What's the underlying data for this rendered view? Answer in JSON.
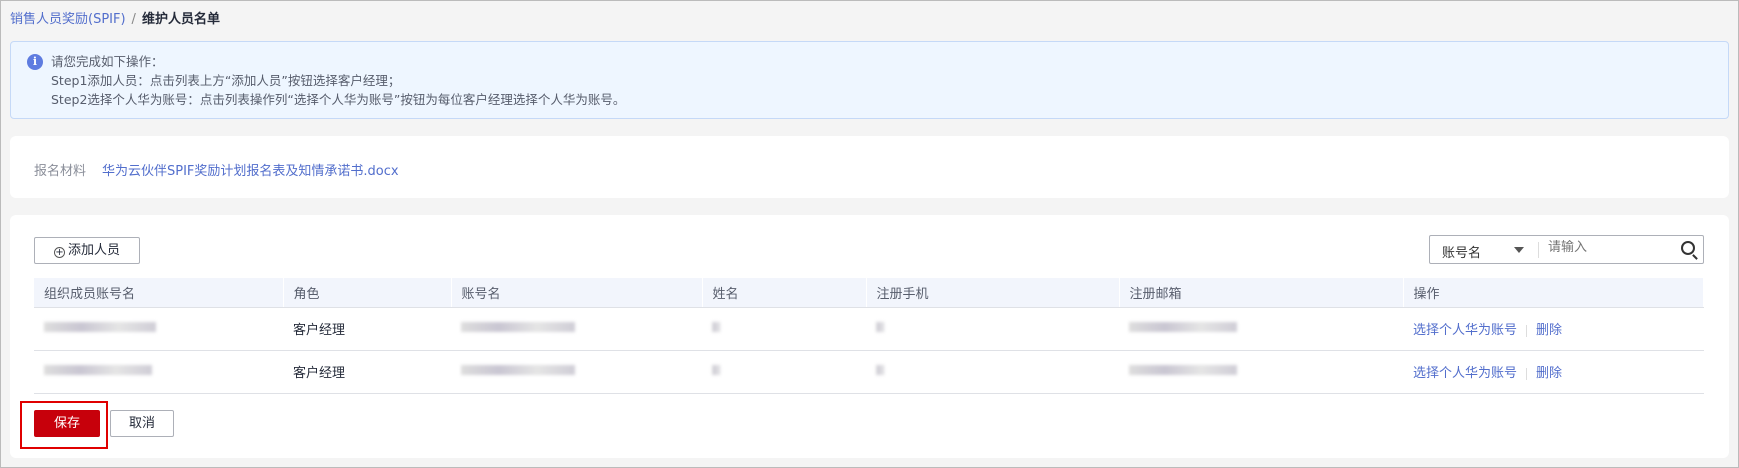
{
  "breadcrumb": {
    "parent": "销售人员奖励(SPIF)",
    "separator": "/",
    "current": "维护人员名单"
  },
  "info": {
    "icon": "info-icon",
    "lines": [
      "请您完成如下操作：",
      "Step1添加人员：点击列表上方“添加人员”按钮选择客户经理；",
      "Step2选择个人华为账号：点击列表操作列“选择个人华为账号”按钮为每位客户经理选择个人华为账号。"
    ]
  },
  "materials": {
    "label": "报名材料",
    "file": "华为云伙伴SPIF奖励计划报名表及知情承诺书.docx"
  },
  "toolbar": {
    "add_label": "添加人员",
    "search_field": "账号名",
    "search_placeholder": "请输入"
  },
  "table": {
    "columns": [
      "组织成员账号名",
      "角色",
      "账号名",
      "姓名",
      "注册手机",
      "注册邮箱",
      "操作"
    ],
    "rows": [
      {
        "role": "客户经理"
      },
      {
        "role": "客户经理"
      }
    ],
    "actions": {
      "select": "选择个人华为账号",
      "delete": "删除"
    }
  },
  "footer": {
    "save": "保存",
    "cancel": "取消"
  },
  "colors": {
    "accent": "#526ecc",
    "primary": "#c7000b",
    "highlight": "#e00000"
  }
}
